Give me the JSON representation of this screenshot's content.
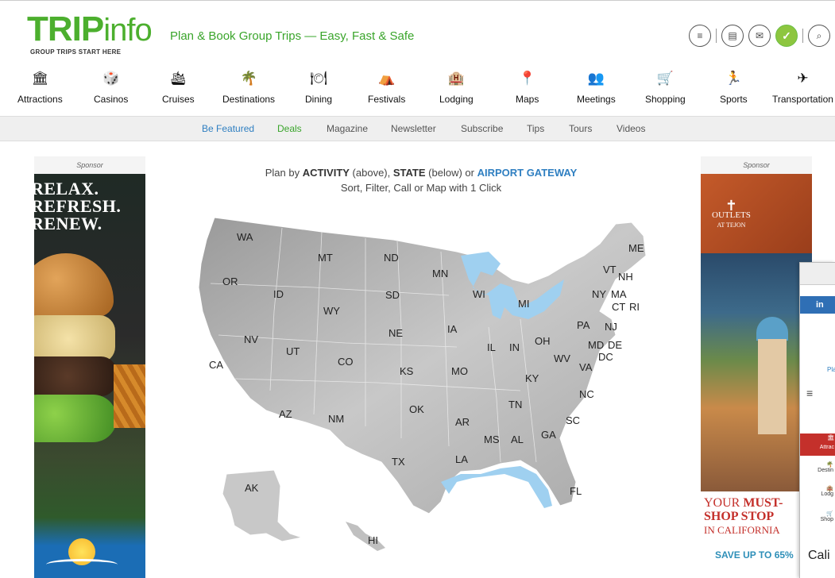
{
  "header": {
    "logo_main_trip": "TRIP",
    "logo_main_info": "info",
    "logo_sub": "GROUP TRIPS START HERE",
    "tagline": "Plan & Book Group Trips — Easy, Fast & Safe",
    "icons": [
      "menu-icon",
      "newspaper-icon",
      "mail-icon",
      "check-icon",
      "search-icon"
    ]
  },
  "categories": [
    {
      "label": "Attractions",
      "icon": "🏛"
    },
    {
      "label": "Casinos",
      "icon": "🎲"
    },
    {
      "label": "Cruises",
      "icon": "🛳"
    },
    {
      "label": "Destinations",
      "icon": "🌴"
    },
    {
      "label": "Dining",
      "icon": "🍽"
    },
    {
      "label": "Festivals",
      "icon": "⛺"
    },
    {
      "label": "Lodging",
      "icon": "🏨"
    },
    {
      "label": "Maps",
      "icon": "📍"
    },
    {
      "label": "Meetings",
      "icon": "👥"
    },
    {
      "label": "Shopping",
      "icon": "🛒"
    },
    {
      "label": "Sports",
      "icon": "🏃"
    },
    {
      "label": "Transportation",
      "icon": "✈"
    }
  ],
  "subnav": [
    "Be Featured",
    "Deals",
    "Magazine",
    "Newsletter",
    "Subscribe",
    "Tips",
    "Tours",
    "Videos"
  ],
  "sponsor_label": "Sponsor",
  "intro": {
    "line1_prefix": "Plan by ",
    "activity": "ACTIVITY",
    "above": " (above), ",
    "state": "STATE",
    "below": " (below) or ",
    "gateway": "AIRPORT GATEWAY",
    "line2": "Sort, Filter, Call or Map with 1 Click"
  },
  "states": [
    "WA",
    "MT",
    "ND",
    "MN",
    "ME",
    "OR",
    "ID",
    "SD",
    "WI",
    "MI",
    "VT",
    "NH",
    "NY",
    "MA",
    "CT",
    "RI",
    "WY",
    "NE",
    "IA",
    "PA",
    "NJ",
    "NV",
    "UT",
    "CO",
    "IL",
    "IN",
    "OH",
    "MD",
    "DE",
    "DC",
    "WV",
    "VA",
    "CA",
    "KS",
    "MO",
    "KY",
    "NC",
    "AZ",
    "NM",
    "OK",
    "TN",
    "AR",
    "SC",
    "MS",
    "AL",
    "GA",
    "TX",
    "LA",
    "FL",
    "AK",
    "HI"
  ],
  "ad_left": {
    "headline": [
      "RELAX.",
      "REFRESH.",
      "RENEW."
    ]
  },
  "ad_right": {
    "brand_line1": "OUTLETS",
    "brand_line2": "AT TEJON",
    "your": "YOUR ",
    "must": "MUST-",
    "shop_stop": "SHOP STOP",
    "in_california": "IN CALIFORNIA",
    "save": "SAVE UP TO 65%"
  },
  "mini": {
    "li": "in",
    "pla": "Pla",
    "attrac": "Attrac",
    "destin": "Destin",
    "lodg": "Lodg",
    "shop": "Shop",
    "cali": "Cali"
  }
}
